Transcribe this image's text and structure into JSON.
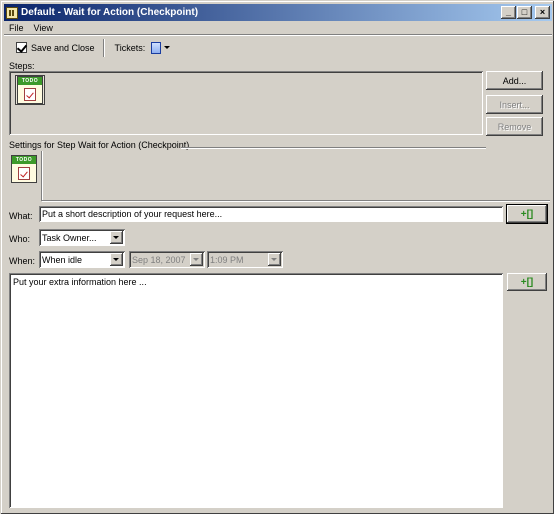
{
  "window": {
    "title": "Default - Wait for Action (Checkpoint)",
    "controls": {
      "minimize": "_",
      "maximize": "□",
      "close": "×"
    }
  },
  "menu": {
    "items": [
      "File",
      "View"
    ]
  },
  "toolbar": {
    "save_close_label": "Save and Close",
    "tickets_label": "Tickets:"
  },
  "steps": {
    "label": "Steps:",
    "icon_text": "TODO",
    "buttons": {
      "add": "Add...",
      "insert": "Insert...",
      "remove": "Remove"
    }
  },
  "settings": {
    "label": "Settings for Step Wait for Action (Checkpoint)",
    "icon_text": "TODO"
  },
  "form": {
    "what_label": "What:",
    "what_value": "Put a short description of your request here...",
    "who_label": "Who:",
    "who_value": "Task Owner...",
    "when_label": "When:",
    "when_value": "When idle",
    "date_value": "Sep 18, 2007",
    "time_value": "1:09 PM",
    "extra_info": "Put your extra information here ...",
    "green_button": "+[]"
  }
}
